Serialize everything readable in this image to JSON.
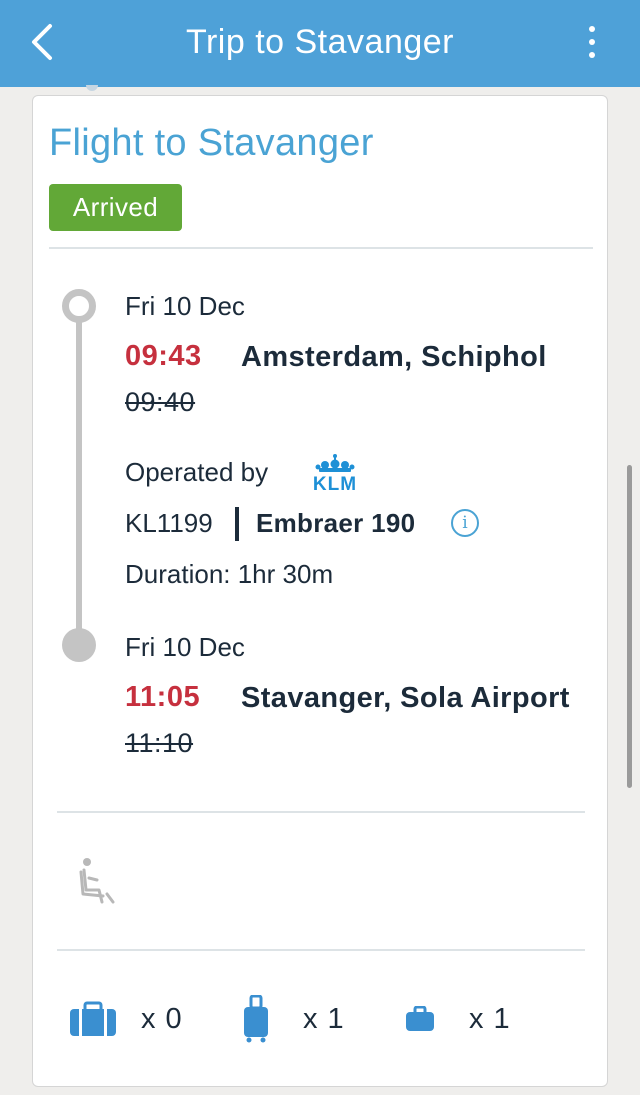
{
  "header": {
    "title": "Trip to Stavanger",
    "back_icon": "chevron-left-icon",
    "menu_icon": "more-vertical-icon"
  },
  "flight": {
    "title": "Flight to Stavanger",
    "status": "Arrived",
    "departure": {
      "date": "Fri 10 Dec",
      "time_actual": "09:43",
      "time_scheduled": "09:40",
      "place": "Amsterdam, Schiphol"
    },
    "operator": {
      "label": "Operated by",
      "airline_logo_text": "KLM"
    },
    "flight_number": "KL1199",
    "aircraft": "Embraer 190",
    "duration": "Duration: 1hr 30m",
    "arrival": {
      "date": "Fri 10 Dec",
      "time_actual": "11:05",
      "time_scheduled": "11:10",
      "place": "Stavanger, Sola Airport"
    }
  },
  "baggage": [
    {
      "icon": "checked-bag-icon",
      "count": "x 0"
    },
    {
      "icon": "cabin-trolley-icon",
      "count": "x 1"
    },
    {
      "icon": "personal-item-icon",
      "count": "x 1"
    }
  ],
  "colors": {
    "header": "#4ea1d8",
    "accent": "#4aa3d4",
    "status_green": "#62a837",
    "delay_red": "#c6303e",
    "text": "#1c2b3a"
  }
}
